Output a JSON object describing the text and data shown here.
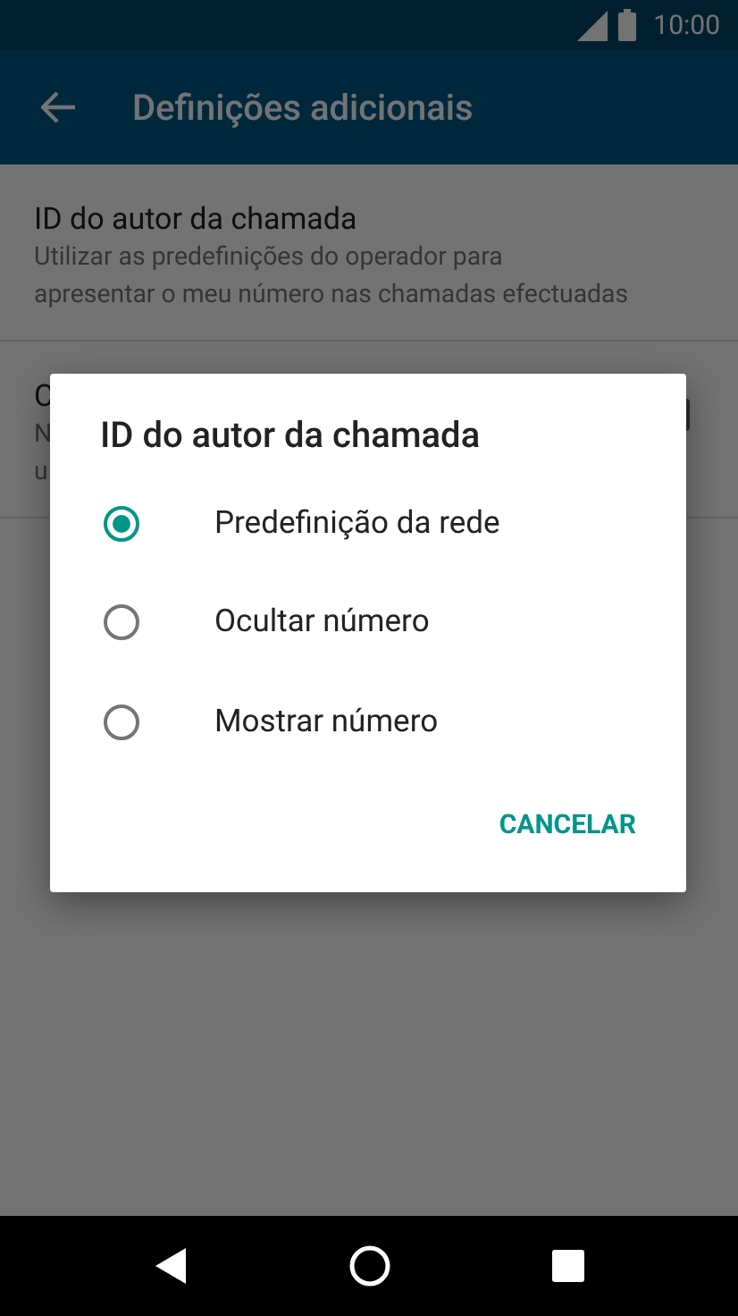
{
  "status_bar": {
    "time": "10:00"
  },
  "app_bar": {
    "title": "Definições adicionais"
  },
  "settings": [
    {
      "title": "ID do autor da chamada",
      "summary_lines": [
        "Utilizar as predefinições do operador para",
        "apresentar o meu número nas chamadas efectuadas"
      ]
    },
    {
      "title": "C",
      "summary_lines": [
        "N",
        "u"
      ]
    }
  ],
  "dialog": {
    "title": "ID do autor da chamada",
    "options": [
      {
        "label": "Predefinição da rede",
        "selected": true
      },
      {
        "label": "Ocultar número",
        "selected": false
      },
      {
        "label": "Mostrar número",
        "selected": false
      }
    ],
    "buttons": [
      "CANCELAR"
    ]
  }
}
